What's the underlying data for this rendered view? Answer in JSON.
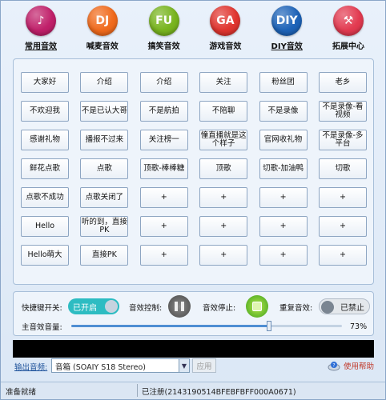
{
  "tabs": [
    {
      "icon_text": "♪",
      "icon_name": "music-note-icon",
      "color": "#c0206a",
      "label": "常用音效",
      "active": true
    },
    {
      "icon_text": "DJ",
      "icon_name": "dj-icon",
      "color": "#f06a1c",
      "label": "喊麦音效",
      "active": false
    },
    {
      "icon_text": "FU",
      "icon_name": "fu-icon",
      "color": "#78b41e",
      "label": "搞笑音效",
      "active": false
    },
    {
      "icon_text": "GA",
      "icon_name": "ga-icon",
      "color": "#e0352f",
      "label": "游戏音效",
      "active": false
    },
    {
      "icon_text": "DIY",
      "icon_name": "diy-icon",
      "color": "#1d63b8",
      "label": "DIY音效",
      "active": true
    },
    {
      "icon_text": "⚒",
      "icon_name": "tools-icon",
      "color": "#e23a50",
      "label": "拓展中心",
      "active": false
    }
  ],
  "grid": [
    [
      "大家好",
      "介绍",
      "介绍",
      "关注",
      "粉丝团",
      "老乡"
    ],
    [
      "不欢迎我",
      "不是已认大哥",
      "不是航拍",
      "不陪聊",
      "不是录像",
      "不是录像-看视频"
    ],
    [
      "感谢礼物",
      "播报不过来",
      "关注榜一",
      "憧直播就是这个样子",
      "官网收礼物",
      "不是录像-多平台"
    ],
    [
      "鲜花点歌",
      "点歌",
      "顶歌-棒棒糖",
      "顶歌",
      "切歌-加油鸭",
      "切歌"
    ],
    [
      "点歌不成功",
      "点歌关闭了",
      "+",
      "+",
      "+",
      "+"
    ],
    [
      "Hello",
      "听的到，直接PK",
      "+",
      "+",
      "+",
      "+"
    ],
    [
      "Hello萌大",
      "直接PK",
      "+",
      "+",
      "+",
      "+"
    ]
  ],
  "controls": {
    "hotkey_label": "快捷键开关:",
    "hotkey_state": "已开启",
    "effect_control_label": "音效控制:",
    "effect_stop_label": "音效停止:",
    "repeat_label": "重复音效:",
    "repeat_state": "已禁止",
    "volume_label": "主音效音量:",
    "volume_text": "73%",
    "volume_value": 0.73
  },
  "output": {
    "label": "输出音频:",
    "device": "音箱 (SOAIY S18 Stereo)",
    "apply_label": "应用",
    "help_label": "使用帮助"
  },
  "status": {
    "left": "准备就绪",
    "right": "已注册(2143190514BFEBFBFF000A0671)"
  }
}
